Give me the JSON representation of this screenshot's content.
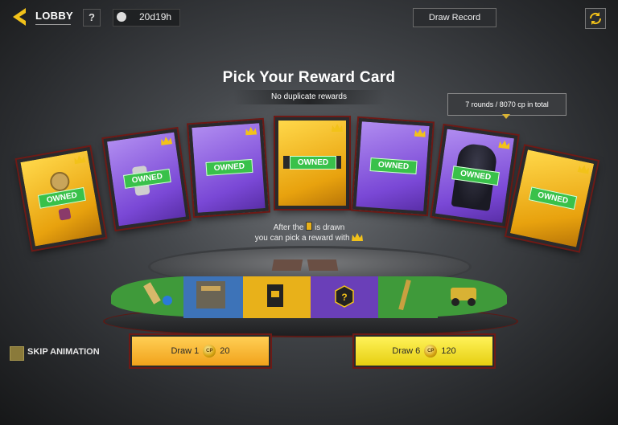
{
  "topbar": {
    "lobby_label": "LOBBY",
    "help_label": "?",
    "timer_text": "20d19h",
    "draw_record_label": "Draw Record"
  },
  "header": {
    "title": "Pick Your Reward Card",
    "subtitle": "No duplicate rewards"
  },
  "tooltip": {
    "text": "7 rounds / 8070 cp in total"
  },
  "cards": [
    {
      "color": "gold",
      "badge": "OWNED",
      "has_crown": true
    },
    {
      "color": "purple",
      "badge": "OWNED",
      "has_crown": true
    },
    {
      "color": "purple",
      "badge": "OWNED",
      "has_crown": true
    },
    {
      "color": "gold",
      "badge": "OWNED",
      "has_crown": true
    },
    {
      "color": "purple",
      "badge": "OWNED",
      "has_crown": true
    },
    {
      "color": "purple",
      "badge": "OWNED",
      "has_crown": true
    },
    {
      "color": "gold",
      "badge": "OWNED",
      "has_crown": true
    }
  ],
  "info": {
    "line1_before": "After the",
    "line1_after": "is drawn",
    "line2": "you can pick a reward with"
  },
  "reward_strip": [
    {
      "color": "#3f9a3a",
      "icon": "grenade-charm-icon"
    },
    {
      "color": "#3d73b8",
      "icon": "ammo-icon"
    },
    {
      "color": "#e8b11a",
      "icon": "card-icon"
    },
    {
      "color": "#6a3fb8",
      "icon": "mystery-icon",
      "label": "?"
    },
    {
      "color": "#3f9a3a",
      "icon": "weapon-icon"
    },
    {
      "color": "#3f9a3a",
      "icon": "vehicle-icon"
    }
  ],
  "skip_animation": {
    "label": "SKIP ANIMATION",
    "checked": false
  },
  "draw_buttons": {
    "draw1": {
      "label": "Draw 1",
      "cost": "20",
      "currency": "CP"
    },
    "draw6": {
      "label": "Draw 6",
      "cost": "120",
      "currency": "CP"
    }
  },
  "colors": {
    "accent_gold": "#f2c21a",
    "owned_green": "#39c14a",
    "frame_red": "#6d1a16"
  }
}
